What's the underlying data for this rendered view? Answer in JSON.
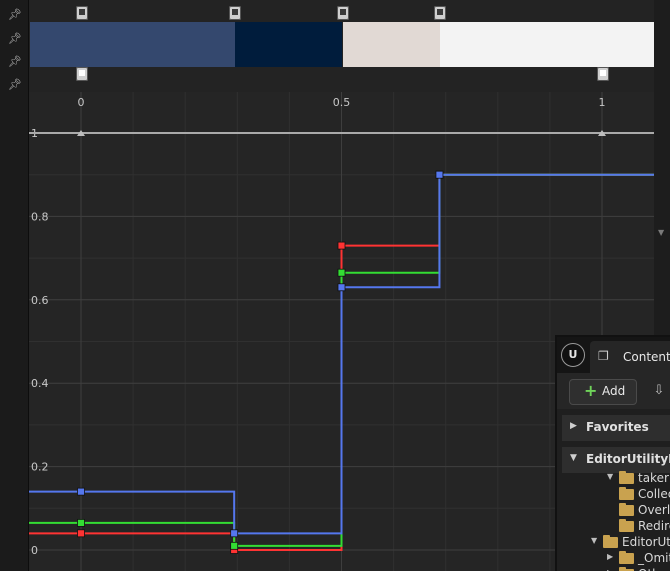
{
  "gradient": {
    "top_stops": [
      0.0,
      0.294,
      0.5,
      0.688
    ],
    "bottom_stops": [
      0.0,
      1.0
    ],
    "colors": [
      "#34486e",
      "#001c3c",
      "#e1d9d4",
      "#f3f3f3"
    ]
  },
  "graph": {
    "x_ticks": [
      {
        "value": 0,
        "label": "0"
      },
      {
        "value": 0.5,
        "label": "0.5"
      },
      {
        "value": 1,
        "label": "1"
      }
    ],
    "y_ticks": [
      {
        "value": 0,
        "label": "0"
      },
      {
        "value": 0.2,
        "label": "0.2"
      },
      {
        "value": 0.4,
        "label": "0.4"
      },
      {
        "value": 0.6,
        "label": "0.6"
      },
      {
        "value": 0.8,
        "label": "0.8"
      },
      {
        "value": 1,
        "label": "1"
      }
    ],
    "x_range": [
      -0.1,
      1.1
    ],
    "y_range": [
      -0.02,
      1.1
    ]
  },
  "chart_data": {
    "type": "line",
    "step": true,
    "xlim": [
      -0.1,
      1.1
    ],
    "ylim": [
      -0.02,
      1.1
    ],
    "series": [
      {
        "color": "#ff3333",
        "x": [
          0,
          0.294,
          0.5,
          0.688
        ],
        "y": [
          0.04,
          0.0,
          0.73,
          0.9
        ]
      },
      {
        "color": "#33dd33",
        "x": [
          0,
          0.294,
          0.5,
          0.688
        ],
        "y": [
          0.065,
          0.01,
          0.665,
          0.9
        ]
      },
      {
        "color": "#5577ee",
        "x": [
          0,
          0.294,
          0.5,
          0.688
        ],
        "y": [
          0.14,
          0.04,
          0.63,
          0.9
        ]
      },
      {
        "color": "#aaaaaa",
        "x": [
          0,
          1
        ],
        "y": [
          1,
          1
        ]
      }
    ]
  },
  "content_browser": {
    "tab_label": "Content",
    "add_label": "Add",
    "favorites_label": "Favorites",
    "root_label": "EditorUtilityBoc",
    "tree": [
      {
        "label": "taker",
        "indent": 1,
        "expanded": true
      },
      {
        "label": "Collec",
        "indent": 2,
        "expanded": false
      },
      {
        "label": "Overla",
        "indent": 2,
        "expanded": false
      },
      {
        "label": "Redire",
        "indent": 2,
        "expanded": false
      },
      {
        "label": "EditorUtil",
        "indent": 0,
        "expanded": true
      },
      {
        "label": "_Omit",
        "indent": 1,
        "expanded": false
      },
      {
        "label": "Other",
        "indent": 1,
        "expanded": false
      }
    ]
  }
}
